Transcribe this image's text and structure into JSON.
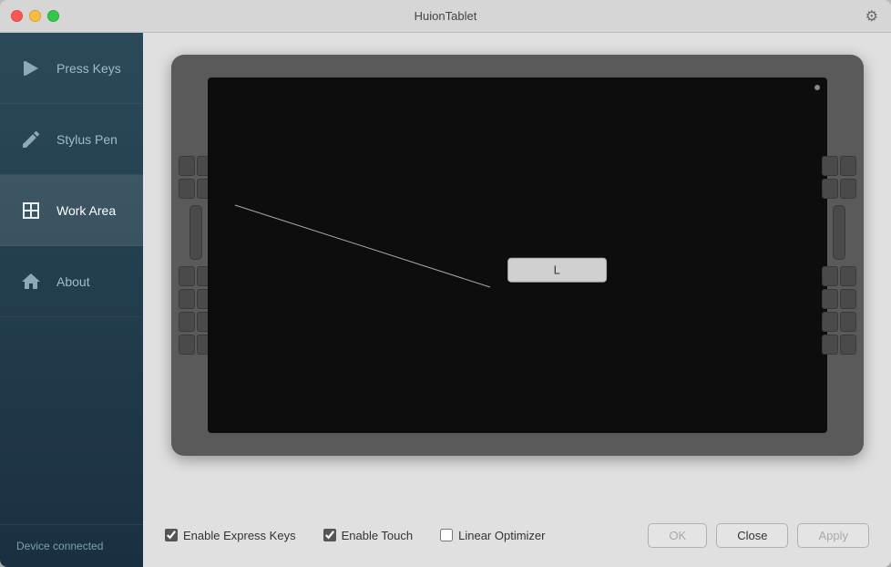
{
  "window": {
    "title": "HuionTablet",
    "controls": {
      "close": "close",
      "minimize": "minimize",
      "maximize": "maximize"
    }
  },
  "sidebar": {
    "items": [
      {
        "id": "press-keys",
        "label": "Press Keys",
        "active": false
      },
      {
        "id": "stylus-pen",
        "label": "Stylus Pen",
        "active": false
      },
      {
        "id": "work-area",
        "label": "Work Area",
        "active": true
      },
      {
        "id": "about",
        "label": "About",
        "active": false
      }
    ],
    "footer": {
      "status": "Device connected"
    }
  },
  "tablet": {
    "label": "L",
    "indicator": "dot"
  },
  "bottom": {
    "checkboxes": [
      {
        "id": "enable-express-keys",
        "label": "Enable Express Keys",
        "checked": true
      },
      {
        "id": "enable-touch",
        "label": "Enable Touch",
        "checked": true
      },
      {
        "id": "linear-optimizer",
        "label": "Linear Optimizer",
        "checked": false
      }
    ],
    "buttons": [
      {
        "id": "ok",
        "label": "OK"
      },
      {
        "id": "close",
        "label": "Close"
      },
      {
        "id": "apply",
        "label": "Apply"
      }
    ]
  },
  "icons": {
    "gear": "⚙",
    "press-keys": "arrow",
    "stylus-pen": "pen",
    "work-area": "area",
    "about": "home"
  }
}
